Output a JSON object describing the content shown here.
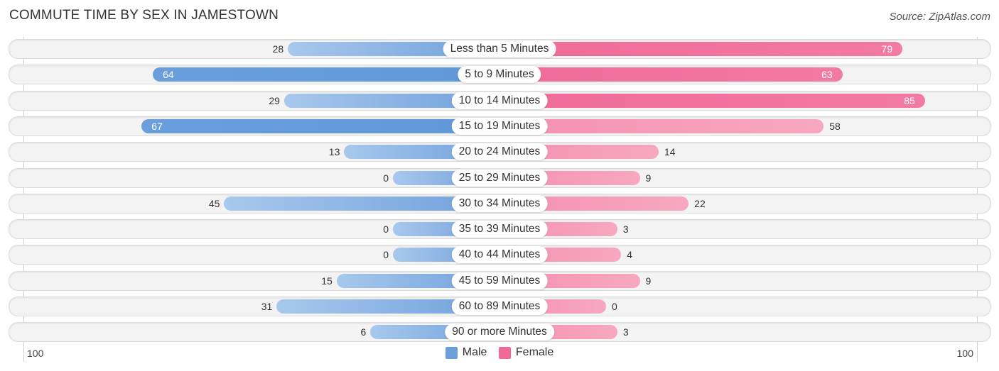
{
  "header": {
    "title": "COMMUTE TIME BY SEX IN JAMESTOWN",
    "source": "Source: ZipAtlas.com"
  },
  "colors": {
    "male": "#6a9fdc",
    "female": "#f06a98"
  },
  "chart_data": {
    "type": "bar",
    "orientation": "horizontal-diverging",
    "title": "COMMUTE TIME BY SEX IN JAMESTOWN",
    "categories": [
      "Less than 5 Minutes",
      "5 to 9 Minutes",
      "10 to 14 Minutes",
      "15 to 19 Minutes",
      "20 to 24 Minutes",
      "25 to 29 Minutes",
      "30 to 34 Minutes",
      "35 to 39 Minutes",
      "40 to 44 Minutes",
      "45 to 59 Minutes",
      "60 to 89 Minutes",
      "90 or more Minutes"
    ],
    "series": [
      {
        "name": "Male",
        "values": [
          28,
          64,
          29,
          67,
          13,
          0,
          45,
          0,
          0,
          15,
          31,
          6
        ]
      },
      {
        "name": "Female",
        "values": [
          79,
          63,
          85,
          58,
          14,
          9,
          22,
          3,
          4,
          9,
          0,
          3
        ]
      }
    ],
    "axis": {
      "left_label": "100",
      "right_label": "100",
      "range": [
        0,
        100
      ]
    },
    "legend": {
      "entries": [
        "Male",
        "Female"
      ],
      "placement": "bottom-center"
    }
  }
}
